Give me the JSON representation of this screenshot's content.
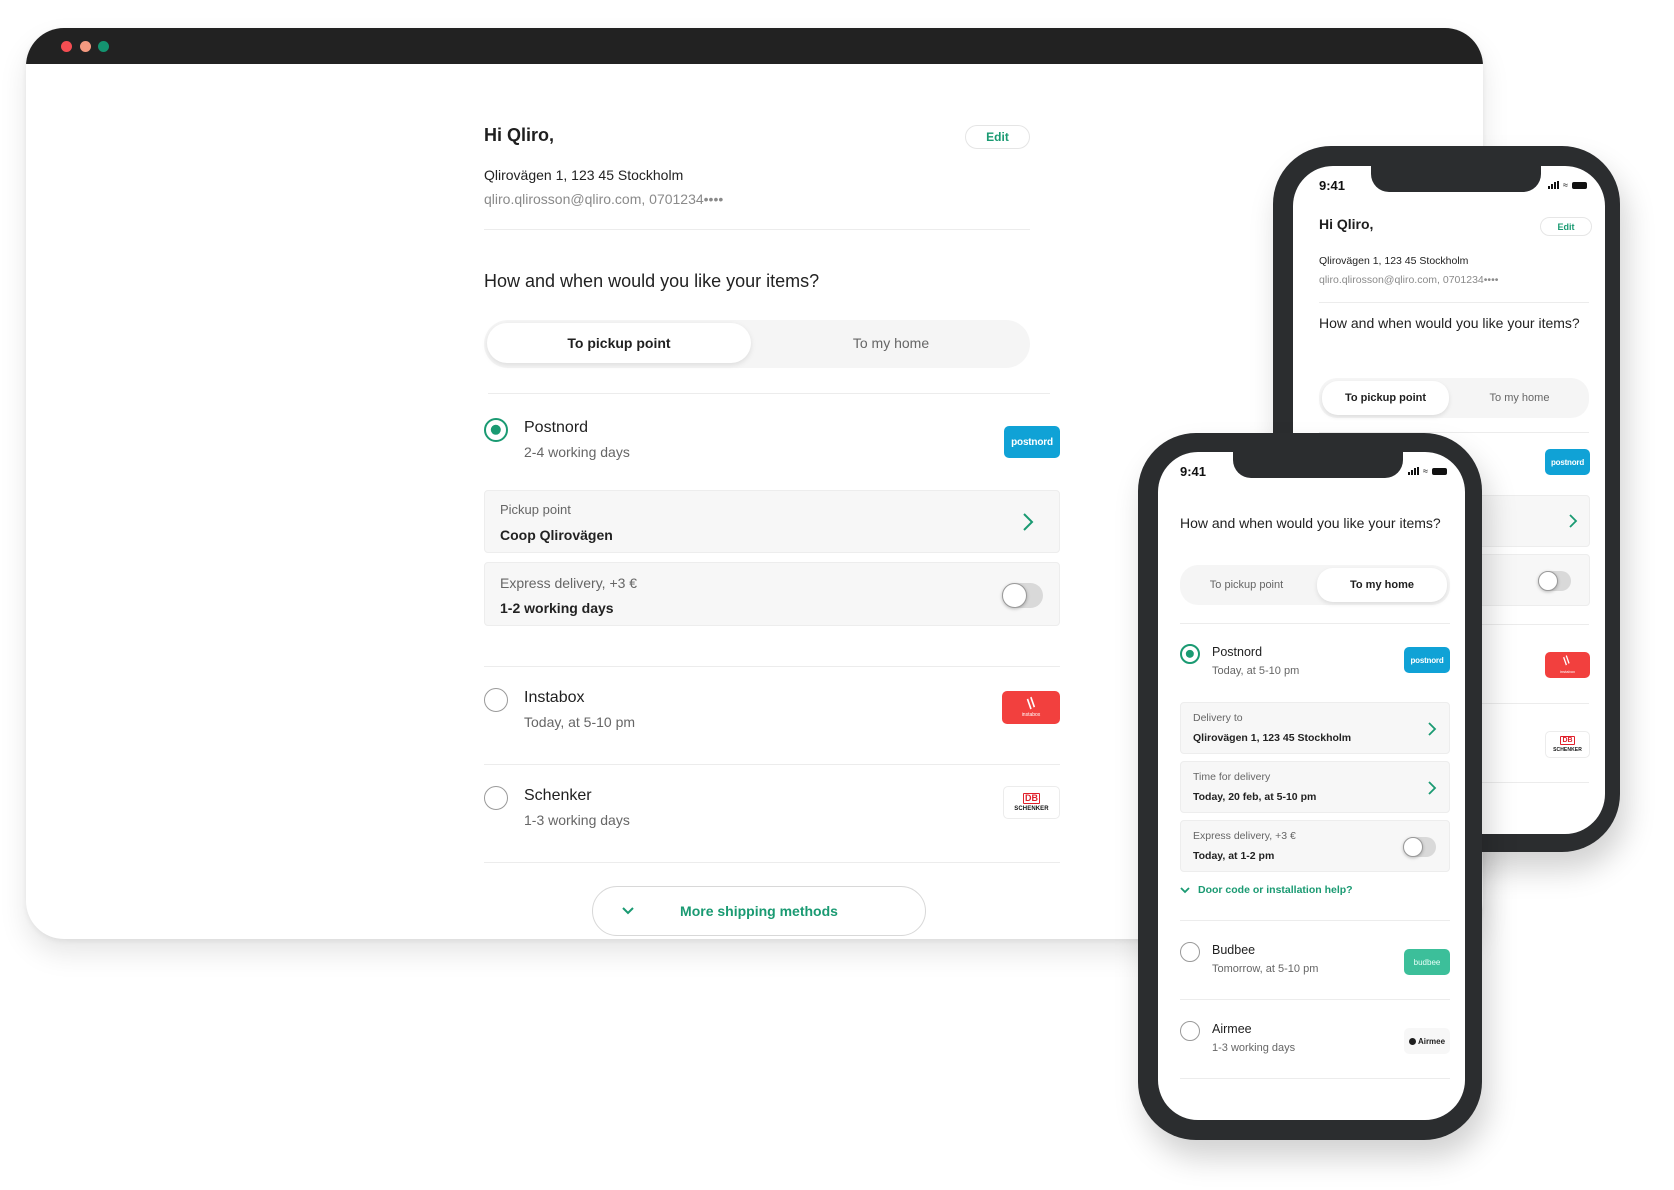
{
  "desktop": {
    "window_controls": [
      "close",
      "minimize",
      "maximize"
    ],
    "greeting": "Hi Qliro,",
    "edit_label": "Edit",
    "address": "Qlirovägen 1, 123 45 Stockholm",
    "contact": "qliro.qlirosson@qliro.com, 0701234••••",
    "question": "How and when would you like your items?",
    "tabs": [
      {
        "label": "To pickup point",
        "active": true
      },
      {
        "label": "To my home",
        "active": false
      }
    ],
    "carriers": [
      {
        "name": "Postnord",
        "sub": "2-4 working days",
        "selected": true,
        "logo_text": "postnord"
      },
      {
        "name": "Instabox",
        "sub": "Today, at 5-10 pm",
        "selected": false,
        "logo_text": "instabox"
      },
      {
        "name": "Schenker",
        "sub": "1-3 working days",
        "selected": false,
        "logo_text": "SCHENKER",
        "logo_badge": "DB"
      }
    ],
    "pickup_card": {
      "label": "Pickup point",
      "value": "Coop Qlirovägen"
    },
    "express_card": {
      "label": "Express delivery, +3 €",
      "value": "1-2 working days",
      "enabled": false
    },
    "more_label": "More shipping methods"
  },
  "phone_back": {
    "time": "9:41",
    "greeting": "Hi Qliro,",
    "edit_label": "Edit",
    "address": "Qlirovägen 1, 123 45 Stockholm",
    "contact": "qliro.qlirosson@qliro.com, 0701234••••",
    "question": "How and when would you like your items?",
    "tabs": [
      {
        "label": "To pickup point",
        "active": true
      },
      {
        "label": "To my home",
        "active": false
      }
    ],
    "logos": [
      "postnord",
      "instabox",
      "SCHENKER"
    ],
    "express_enabled": false
  },
  "phone_front": {
    "time": "9:41",
    "question": "How and when would you like your items?",
    "tabs": [
      {
        "label": "To pickup point",
        "active": false
      },
      {
        "label": "To my home",
        "active": true
      }
    ],
    "carriers": [
      {
        "name": "Postnord",
        "sub": "Today, at 5-10 pm",
        "selected": true,
        "logo_text": "postnord"
      },
      {
        "name": "Budbee",
        "sub": "Tomorrow, at 5-10 pm",
        "selected": false,
        "logo_text": "budbee"
      },
      {
        "name": "Airmee",
        "sub": "1-3 working days",
        "selected": false,
        "logo_text": "Airmee"
      }
    ],
    "delivery_card": {
      "label": "Delivery to",
      "value": "Qlirovägen 1, 123 45 Stockholm"
    },
    "time_card": {
      "label": "Time for delivery",
      "value": "Today, 20 feb, at 5-10 pm"
    },
    "express_card": {
      "label": "Express delivery, +3 €",
      "value": "Today, at 1-2 pm",
      "enabled": false
    },
    "help_link": "Door code or installation help?"
  },
  "colors": {
    "accent": "#1a9a72",
    "postnord": "#10a2d6",
    "instabox": "#f2403e",
    "budbee": "#3cbf9a",
    "db_red": "#e0202b",
    "frame": "#2b2d2f",
    "titlebar": "#222222"
  }
}
